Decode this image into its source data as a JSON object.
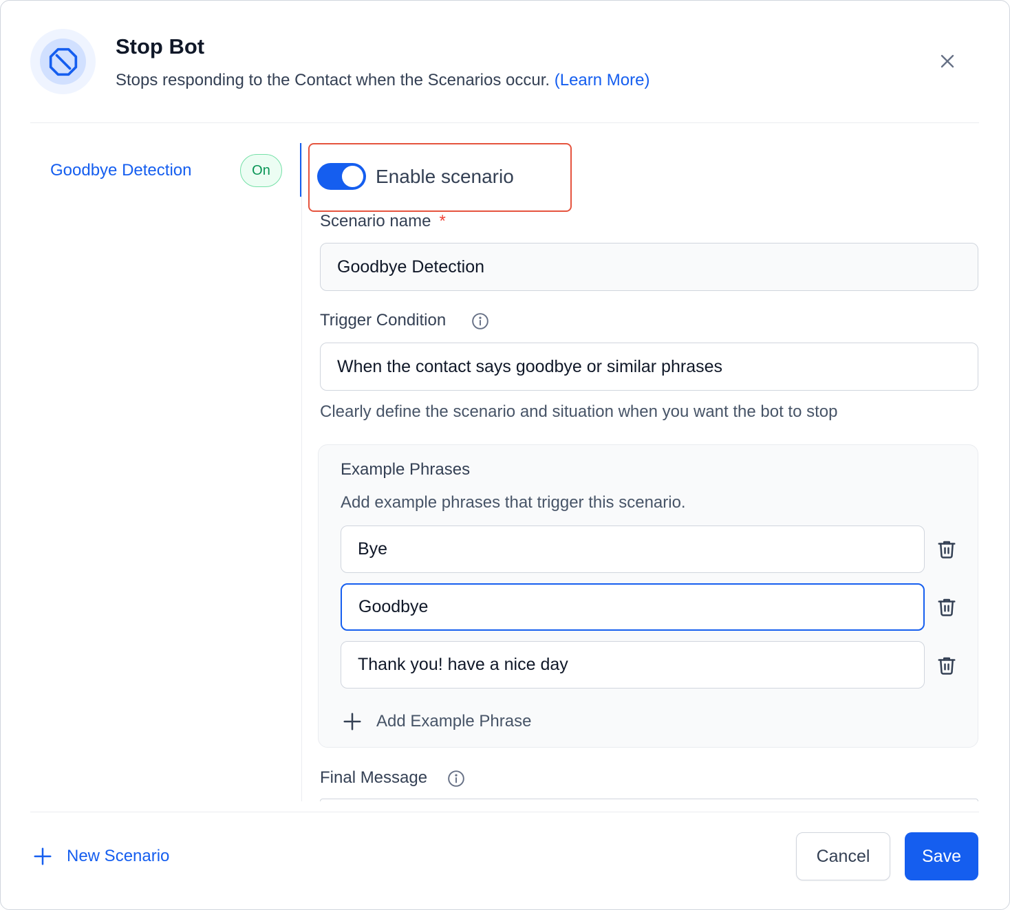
{
  "header": {
    "title": "Stop Bot",
    "subtitle": "Stops responding to the Contact when the Scenarios occur.",
    "learn_more": "(Learn More)",
    "icon": "stop-octagon-icon"
  },
  "sidebar": {
    "items": [
      {
        "label": "Goodbye Detection",
        "status": "On",
        "active": true
      }
    ]
  },
  "form": {
    "enable_toggle": {
      "label": "Enable scenario",
      "on": true
    },
    "scenario_name": {
      "label": "Scenario name",
      "required_mark": "*",
      "value": "Goodbye Detection"
    },
    "trigger_condition": {
      "label": "Trigger Condition",
      "value": "When the contact says goodbye or similar phrases",
      "hint": "Clearly define the scenario and situation when you want the bot to stop"
    },
    "example_phrases": {
      "title": "Example Phrases",
      "subtitle": "Add example phrases that trigger this scenario.",
      "items": [
        "Bye",
        "Goodbye",
        "Thank you! have a nice day"
      ],
      "add_label": "Add Example Phrase"
    },
    "final_message": {
      "label": "Final Message"
    }
  },
  "footer": {
    "new_scenario": "New Scenario",
    "cancel": "Cancel",
    "save": "Save"
  },
  "colors": {
    "accent": "#155eef",
    "success": "#079455",
    "highlight": "#e5533d"
  }
}
